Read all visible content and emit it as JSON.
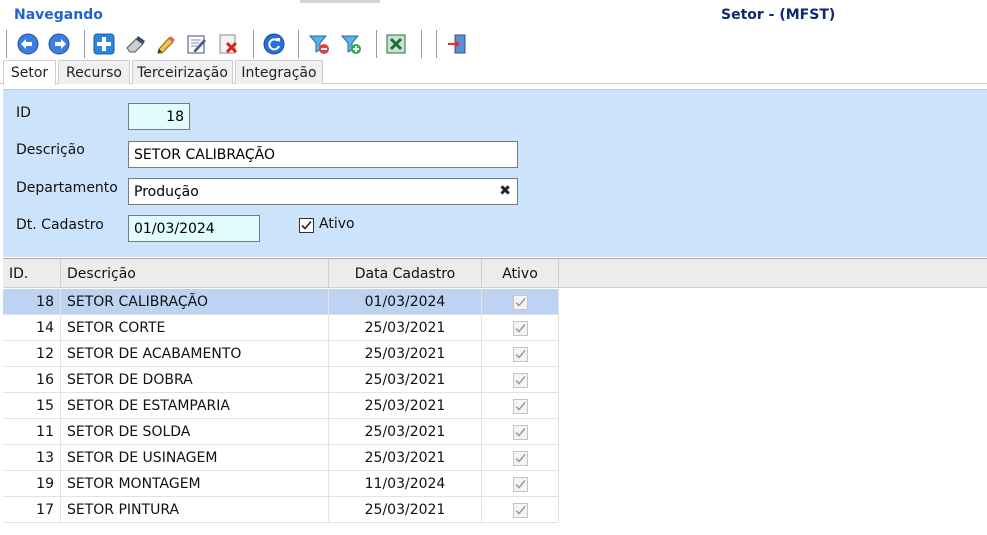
{
  "header": {
    "status": "Navegando",
    "title": "Setor - (MFST)"
  },
  "toolbar": {
    "buttons": [
      {
        "icon": "arrow-left-icon"
      },
      {
        "icon": "arrow-right-icon"
      },
      {
        "icon": "add-icon"
      },
      {
        "icon": "eraser-icon"
      },
      {
        "icon": "pencil-icon"
      },
      {
        "icon": "edit-note-icon"
      },
      {
        "icon": "delete-icon"
      },
      {
        "icon": "refresh-icon"
      },
      {
        "icon": "filter-remove-icon"
      },
      {
        "icon": "filter-add-icon"
      },
      {
        "icon": "excel-icon"
      },
      {
        "icon": "exit-icon"
      }
    ]
  },
  "tabs": [
    "Setor",
    "Recurso",
    "Terceirização",
    "Integração"
  ],
  "form": {
    "id_label": "ID",
    "id_value": "18",
    "descricao_label": "Descrição",
    "descricao_value": "SETOR CALIBRAÇÃO",
    "departamento_label": "Departamento",
    "departamento_value": "Produção",
    "clear_symbol": "✖",
    "dt_cadastro_label": "Dt. Cadastro",
    "dt_cadastro_value": "01/03/2024",
    "ativo_label": "Ativo",
    "ativo_checked": true
  },
  "grid": {
    "columns": [
      "ID.",
      "Descrição",
      "Data Cadastro",
      "Ativo"
    ],
    "rows": [
      {
        "id": "18",
        "descricao": "SETOR CALIBRAÇÃO",
        "data": "01/03/2024",
        "ativo": true
      },
      {
        "id": "14",
        "descricao": "SETOR CORTE",
        "data": "25/03/2021",
        "ativo": true
      },
      {
        "id": "12",
        "descricao": "SETOR DE ACABAMENTO",
        "data": "25/03/2021",
        "ativo": true
      },
      {
        "id": "16",
        "descricao": "SETOR DE DOBRA",
        "data": "25/03/2021",
        "ativo": true
      },
      {
        "id": "15",
        "descricao": "SETOR DE ESTAMPARIA",
        "data": "25/03/2021",
        "ativo": true
      },
      {
        "id": "11",
        "descricao": "SETOR DE SOLDA",
        "data": "25/03/2021",
        "ativo": true
      },
      {
        "id": "13",
        "descricao": "SETOR DE USINAGEM",
        "data": "25/03/2021",
        "ativo": true
      },
      {
        "id": "19",
        "descricao": "SETOR MONTAGEM",
        "data": "11/03/2024",
        "ativo": true
      },
      {
        "id": "17",
        "descricao": "SETOR PINTURA",
        "data": "25/03/2021",
        "ativo": true
      }
    ]
  },
  "colors": {
    "panel": "#cce4fb",
    "selected_row": "#bdd3f1",
    "status": "#1f64c8",
    "title": "#0d2a6e",
    "cyan_field": "#e1fcff"
  }
}
